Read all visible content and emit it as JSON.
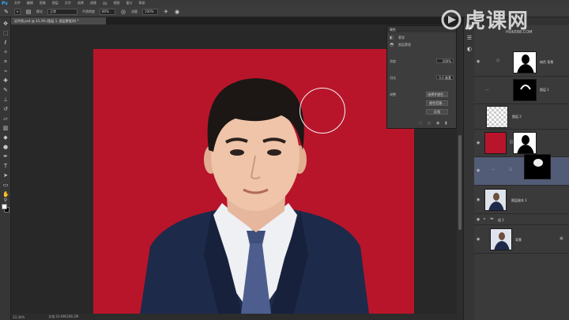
{
  "app": {
    "logo": "Ps"
  },
  "menu": [
    "文件",
    "编辑",
    "图像",
    "图层",
    "文字",
    "选择",
    "滤镜",
    "3D",
    "视图",
    "窗口",
    "帮助"
  ],
  "options_bar": {
    "mode_label": "模式",
    "mode_value": "正常",
    "opacity_label": "不透明度",
    "opacity_value": "80%",
    "flow_label": "流量",
    "flow_value": "100%"
  },
  "document": {
    "tab_title": "证件照.psd @ 33.3% (图层 1, 图层蒙版/8) *",
    "zoom": "33.34%",
    "doc_size": "文档:10.6M/208.2M"
  },
  "properties": {
    "title": "属性",
    "mask_label": "蒙版",
    "layer_mask": "图层蒙版",
    "density_label": "浓度",
    "density_value": "100%",
    "feather_label": "羽化",
    "feather_value": "0.0 像素",
    "refine_label": "调整",
    "btn_select_mask": "选择并遮住...",
    "btn_color_range": "颜色范围...",
    "btn_invert": "反相"
  },
  "layers": [
    {
      "name": "纯色 背景",
      "kind": "fill",
      "visible": true
    },
    {
      "name": "图层 1",
      "kind": "mask",
      "visible": false
    },
    {
      "name": "图层 2",
      "kind": "transparent",
      "visible": false
    },
    {
      "name": "",
      "kind": "red-silhouette",
      "visible": true
    },
    {
      "name": "",
      "kind": "portrait-mask",
      "visible": true,
      "selected": true
    },
    {
      "name": "图层副本 1",
      "kind": "portrait",
      "visible": true
    },
    {
      "name": "组 1",
      "kind": "group",
      "visible": true
    },
    {
      "name": "背景",
      "kind": "portrait",
      "visible": true
    }
  ],
  "watermark": {
    "brand": "虎课网",
    "url": "HUKE88.COM"
  },
  "colors": {
    "photo_background": "#b8152b",
    "suit": "#1e2a4a",
    "panel": "#3a3a3a",
    "selected_layer": "#535c76"
  }
}
